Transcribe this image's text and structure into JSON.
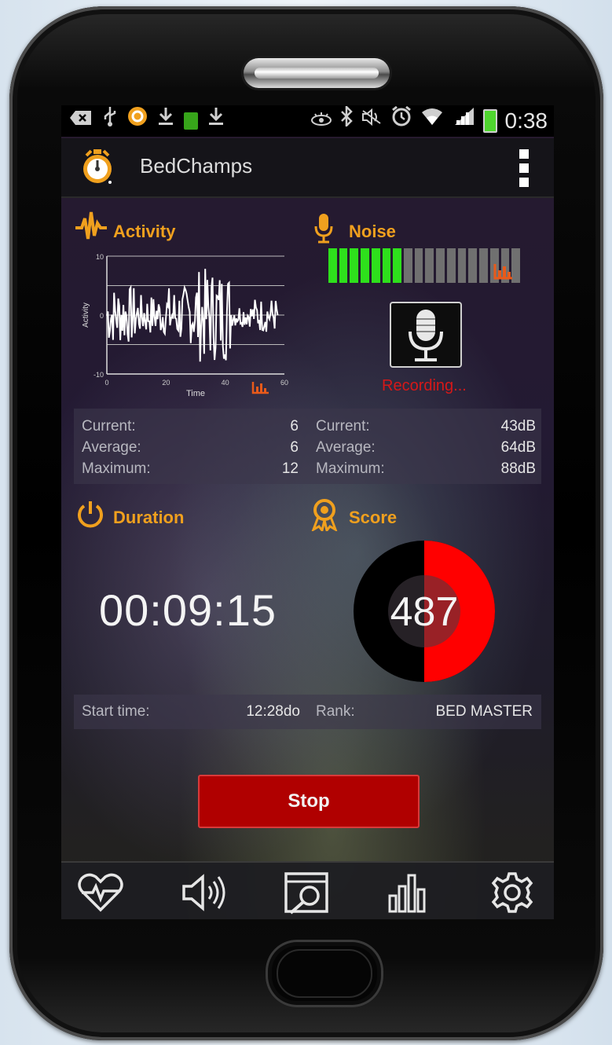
{
  "status_bar": {
    "time": "0:38",
    "icons": [
      "notification-icon",
      "usb-icon",
      "app-icon",
      "download-icon",
      "battery-full-icon",
      "download-icon",
      "eye-icon",
      "bluetooth-icon",
      "silent-icon",
      "alarm-icon",
      "wifi-icon",
      "signal-icon",
      "battery-icon"
    ]
  },
  "app_bar": {
    "title": "BedChamps"
  },
  "activity": {
    "label": "Activity",
    "chart_data": {
      "type": "line",
      "xlabel": "Time",
      "ylabel": "Activity",
      "xlim": [
        0,
        60
      ],
      "ylim": [
        -10,
        10
      ],
      "x_ticks": [
        "0",
        "20",
        "40",
        "60"
      ],
      "y_ticks": [
        "10",
        "0",
        "-10"
      ],
      "grid": true
    }
  },
  "noise": {
    "label": "Noise",
    "level_segments_on": 7,
    "level_segments_total": 18,
    "recording_text": "Recording..."
  },
  "activity_stats": {
    "current_label": "Current:",
    "current_value": "6",
    "average_label": "Average:",
    "average_value": "6",
    "maximum_label": "Maximum:",
    "maximum_value": "12"
  },
  "noise_stats": {
    "current_label": "Current:",
    "current_value": "43dB",
    "average_label": "Average:",
    "average_value": "64dB",
    "maximum_label": "Maximum:",
    "maximum_value": "88dB"
  },
  "duration": {
    "label": "Duration",
    "value": "00:09:15",
    "start_label": "Start time:",
    "start_value": "12:28do"
  },
  "score": {
    "label": "Score",
    "value": "487",
    "fill_fraction": 0.5,
    "rank_label": "Rank:",
    "rank_value": "BED MASTER"
  },
  "stop_button": {
    "label": "Stop"
  },
  "nav": [
    "heart-icon",
    "speaker-icon",
    "search-icon",
    "bar-chart-icon",
    "gear-icon"
  ],
  "colors": {
    "accent": "#f0a01e",
    "recording": "#d61818",
    "stop": "#b00000",
    "score_fill": "#ff0000",
    "noise_on": "#2ee01c",
    "noise_off": "#707070"
  }
}
